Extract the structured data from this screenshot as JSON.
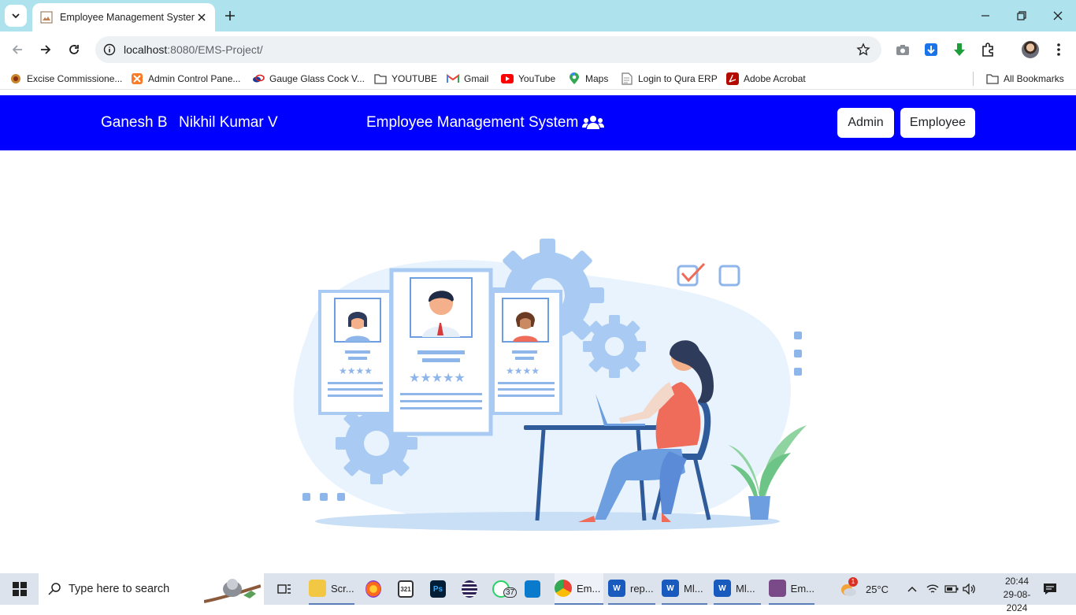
{
  "browser": {
    "tab": {
      "title": "Employee Management System"
    },
    "url": {
      "host": "localhost",
      "path": ":8080/EMS-Project/"
    },
    "bookmarks": [
      {
        "label": "Excise Commissione...",
        "icon": "seal-icon"
      },
      {
        "label": "Admin Control Pane...",
        "icon": "xampp-icon"
      },
      {
        "label": "Gauge Glass Cock V...",
        "icon": "brand-icon"
      },
      {
        "label": "YOUTUBE",
        "icon": "folder-icon"
      },
      {
        "label": "Gmail",
        "icon": "gmail-icon"
      },
      {
        "label": "YouTube",
        "icon": "youtube-icon"
      },
      {
        "label": "Maps",
        "icon": "maps-icon"
      },
      {
        "label": "Login to Qura ERP",
        "icon": "page-icon"
      },
      {
        "label": "Adobe Acrobat",
        "icon": "acrobat-icon"
      }
    ],
    "all_bookmarks": "All Bookmarks"
  },
  "navbar": {
    "name1": "Ganesh B",
    "name2": "Nikhil Kumar V",
    "brand": "Employee Management System",
    "brand_icon": "users-icon",
    "admin_button": "Admin",
    "employee_button": "Employee",
    "bg_color": "#0000ff"
  },
  "taskbar": {
    "search_placeholder": "Type here to search",
    "apps": [
      {
        "label": "Scr...",
        "icon": "file-explorer-icon"
      },
      {
        "label": "",
        "icon": "firefox-icon"
      },
      {
        "label": "",
        "icon": "calendar-icon"
      },
      {
        "label": "",
        "icon": "photoshop-icon"
      },
      {
        "label": "",
        "icon": "eclipse-icon"
      },
      {
        "label": "",
        "icon": "whatsapp-icon",
        "badge": "37"
      },
      {
        "label": "",
        "icon": "vscode-icon"
      },
      {
        "label": "Em...",
        "icon": "chrome-icon"
      },
      {
        "label": "rep...",
        "icon": "word-icon"
      },
      {
        "label": "Ml...",
        "icon": "word-icon"
      },
      {
        "label": "Ml...",
        "icon": "word-icon"
      },
      {
        "label": "Em...",
        "icon": "app-icon"
      }
    ],
    "weather": "25°C",
    "weather_badge": "1",
    "time": "20:44",
    "date": "29-08-2024"
  }
}
